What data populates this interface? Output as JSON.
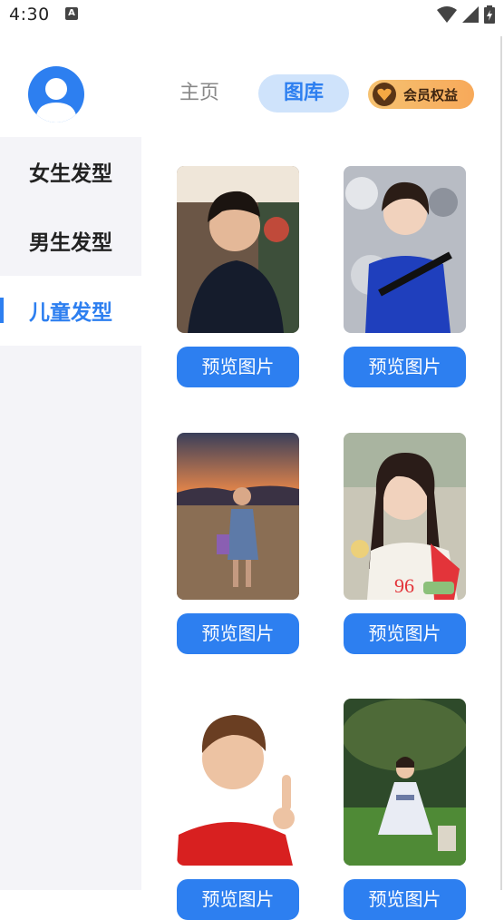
{
  "status_bar": {
    "time": "4:30",
    "notification": "A"
  },
  "header": {
    "tabs": [
      {
        "label": "主页"
      },
      {
        "label": "图库"
      }
    ],
    "vip_label": "会员权益"
  },
  "sidebar": {
    "items": [
      {
        "label": "女生发型"
      },
      {
        "label": "男生发型"
      },
      {
        "label": "儿童发型"
      }
    ],
    "active_index": 2
  },
  "gallery": {
    "button_label": "预览图片",
    "items": [
      {
        "subject": "boy with undercut in dark shirt"
      },
      {
        "subject": "boy in blue shirt with bag strap"
      },
      {
        "subject": "girl in field at sunset"
      },
      {
        "subject": "girl with pigtails in red-white shirt"
      },
      {
        "subject": "boy in red polo pointing up"
      },
      {
        "subject": "girl in white dress on lawn"
      }
    ]
  },
  "colors": {
    "accent": "#2d7ff0",
    "sidebar_bg": "#f4f4f8",
    "vip_gradient": [
      "#f6c271",
      "#f7a95a"
    ]
  }
}
